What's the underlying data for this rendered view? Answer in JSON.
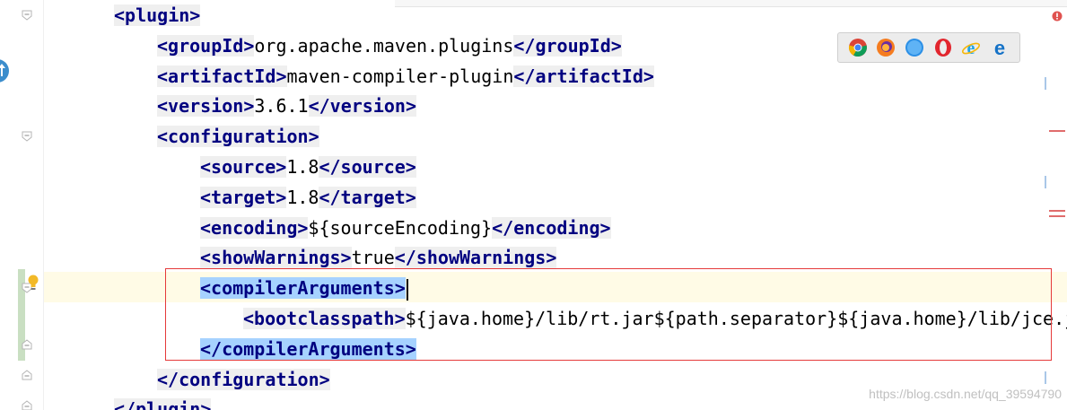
{
  "editor": {
    "lines": [
      {
        "indent": 0,
        "parts": [
          [
            "tag",
            "<plugin>"
          ]
        ]
      },
      {
        "indent": 1,
        "parts": [
          [
            "tag",
            "<groupId>"
          ],
          [
            "val",
            "org.apache.maven.plugins"
          ],
          [
            "tag",
            "</groupId>"
          ]
        ]
      },
      {
        "indent": 1,
        "parts": [
          [
            "tag",
            "<artifactId>"
          ],
          [
            "val",
            "maven-compiler-plugin"
          ],
          [
            "tag",
            "</artifactId>"
          ]
        ]
      },
      {
        "indent": 1,
        "parts": [
          [
            "tag",
            "<version>"
          ],
          [
            "val",
            "3.6.1"
          ],
          [
            "tag",
            "</version>"
          ]
        ]
      },
      {
        "indent": 1,
        "parts": [
          [
            "tag",
            "<configuration>"
          ]
        ]
      },
      {
        "indent": 2,
        "parts": [
          [
            "tag",
            "<source>"
          ],
          [
            "val",
            "1.8"
          ],
          [
            "tag",
            "</source>"
          ]
        ]
      },
      {
        "indent": 2,
        "parts": [
          [
            "tag",
            "<target>"
          ],
          [
            "val",
            "1.8"
          ],
          [
            "tag",
            "</target>"
          ]
        ]
      },
      {
        "indent": 2,
        "parts": [
          [
            "tag",
            "<encoding>"
          ],
          [
            "val",
            "${sourceEncoding}"
          ],
          [
            "tag",
            "</encoding>"
          ]
        ]
      },
      {
        "indent": 2,
        "parts": [
          [
            "tag",
            "<showWarnings>"
          ],
          [
            "val",
            "true"
          ],
          [
            "tag",
            "</showWarnings>"
          ]
        ]
      },
      {
        "indent": 2,
        "parts": [
          [
            "tagsel",
            "<compilerArguments>"
          ],
          [
            "caret",
            ""
          ]
        ]
      },
      {
        "indent": 3,
        "parts": [
          [
            "tag",
            "<bootclasspath>"
          ],
          [
            "val",
            "${java.home}/lib/rt.jar${path.separator}${java.home}/lib/jce.j"
          ]
        ]
      },
      {
        "indent": 2,
        "parts": [
          [
            "tagsel",
            "</compilerArguments>"
          ]
        ]
      },
      {
        "indent": 1,
        "parts": [
          [
            "tag",
            "</configuration>"
          ]
        ]
      },
      {
        "indent": 0,
        "parts": [
          [
            "tag",
            "</plugin>"
          ]
        ]
      }
    ]
  },
  "browser_icons": [
    "chrome-icon",
    "firefox-icon",
    "safari-icon",
    "opera-icon",
    "ie-icon",
    "edge-icon"
  ],
  "watermark": "https://blog.csdn.net/qq_39594790",
  "colors": {
    "tag": "#000080",
    "selection": "#a6d2ff",
    "highlight_box": "#e53a3a"
  }
}
